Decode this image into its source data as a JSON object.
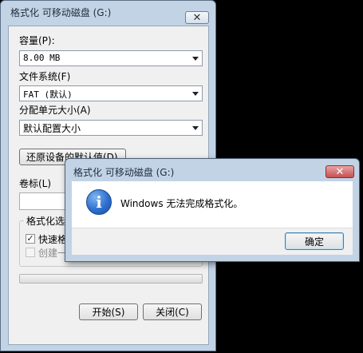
{
  "format_window": {
    "title": "格式化 可移动磁盘 (G:)",
    "close_glyph": "✕",
    "capacity": {
      "label": "容量(P):",
      "value": "8.00 MB"
    },
    "file_system": {
      "label": "文件系统(F)",
      "value": "FAT (默认)"
    },
    "allocation": {
      "label": "分配单元大小(A)",
      "value": "默认配置大小"
    },
    "restore_button": "还原设备的默认值(D)",
    "volume_label": {
      "label": "卷标(L)",
      "value": ""
    },
    "options": {
      "title": "格式化选项",
      "quick_format": {
        "label": "快速格式化(Q)",
        "checked": true
      },
      "create_msdos": {
        "label": "创建一个 MS-DOS 启动盘(M)",
        "checked": false
      }
    },
    "progress_percent": 0,
    "start_button": "开始(S)",
    "close_button": "关闭(C)"
  },
  "message_box": {
    "title": "格式化 可移动磁盘 (G:)",
    "close_glyph": "✕",
    "icon": "information-icon",
    "message": "Windows 无法完成格式化。",
    "ok_button": "确定"
  },
  "colors": {
    "frame": "#c3d3e6",
    "client": "#f0f0f0",
    "close_button_red": "#c75050",
    "info_blue": "#2e6fcf"
  }
}
